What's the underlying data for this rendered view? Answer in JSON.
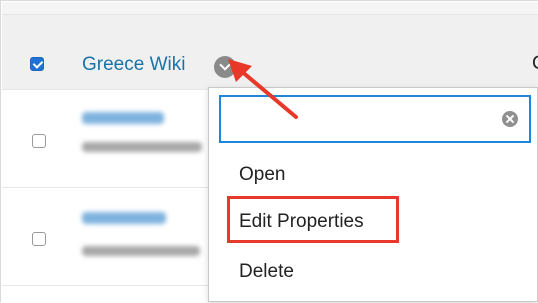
{
  "header_row": {
    "title": "Greece Wiki",
    "column_head_partial": "C"
  },
  "dropdown": {
    "search_value": "",
    "search_placeholder": "",
    "items": [
      "Open",
      "Edit Properties",
      "Delete"
    ]
  },
  "annotation": {
    "highlighted_item": "Edit Properties",
    "arrow_color": "#e8382a",
    "box_color": "#e8382a"
  },
  "colors": {
    "link": "#1a73a8",
    "checkbox_checked": "#1f72d6",
    "search_focus": "#1f86d9"
  }
}
